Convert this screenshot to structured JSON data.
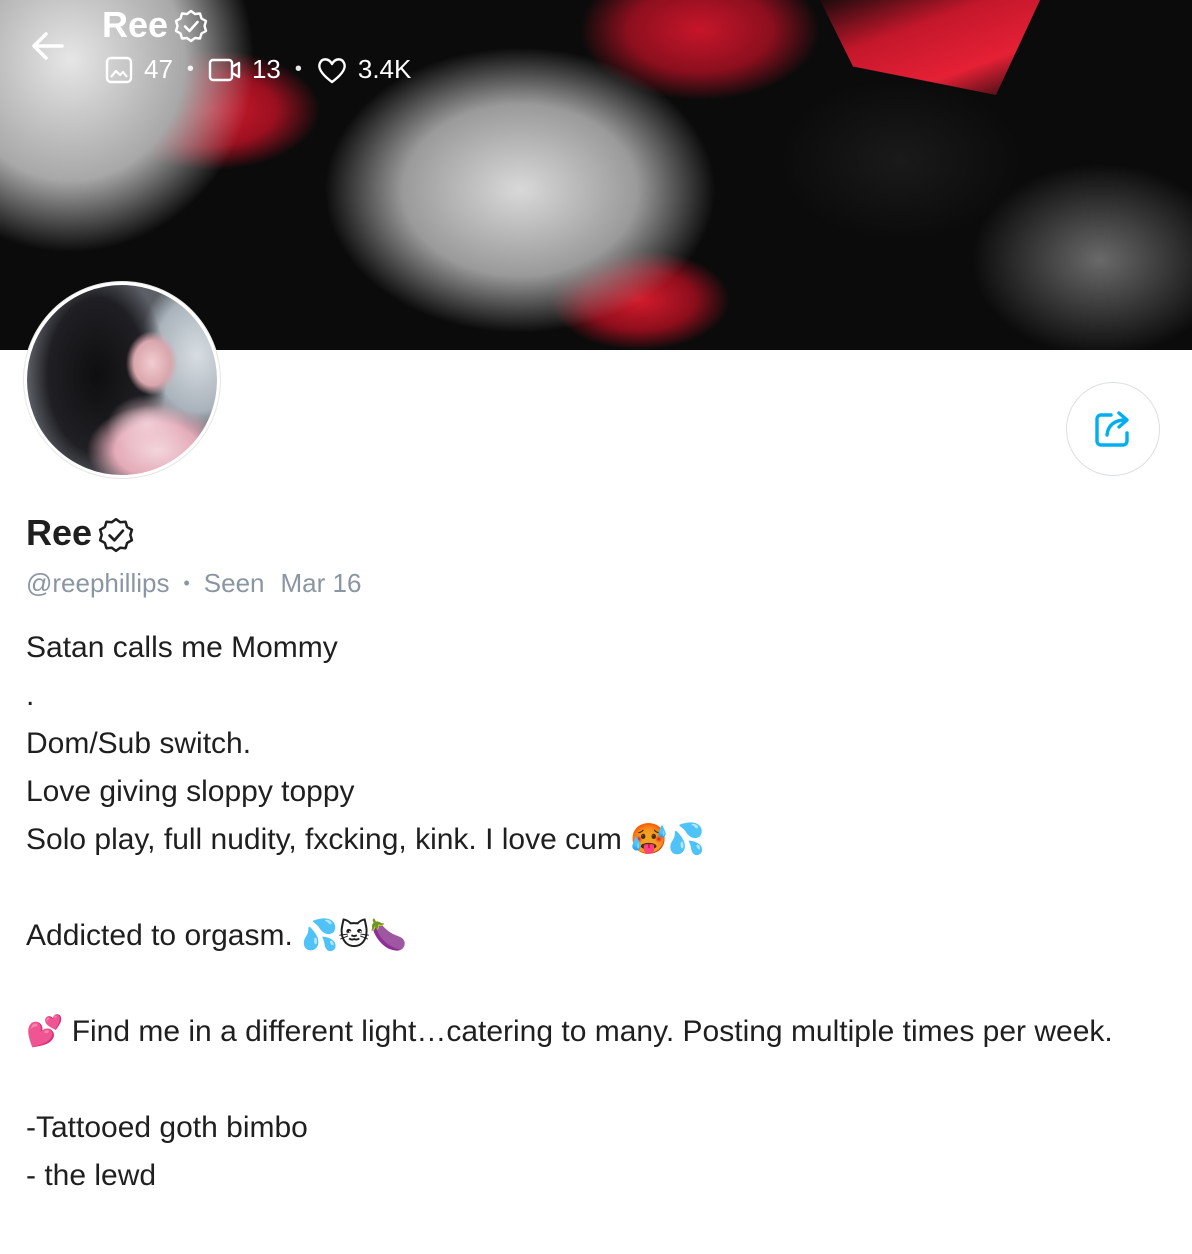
{
  "header": {
    "title": "Ree",
    "stats": {
      "photos": "47",
      "videos": "13",
      "likes": "3.4K"
    }
  },
  "profile": {
    "name": "Ree",
    "handle": "@reephillips",
    "seen_label": "Seen",
    "seen_date": "Mar 16",
    "verified": true
  },
  "bio": {
    "lines": [
      "Satan calls me Mommy",
      ".",
      "Dom/Sub switch.",
      "Love giving sloppy toppy",
      "Solo play, full nudity, fxcking, kink. I love cum 🥵💦",
      "",
      "Addicted to orgasm. 💦🐱🍆",
      "",
      "💕 Find me in a different light…catering to many. Posting multiple times per week.",
      "",
      "-Tattooed goth bimbo",
      "- the lewd"
    ]
  },
  "colors": {
    "accent": "#00aff0",
    "muted_text": "#8a96a3",
    "text": "#1f1f1f"
  },
  "icons": {
    "back": "arrow-left-icon",
    "photos": "image-icon",
    "videos": "video-icon",
    "likes": "heart-icon",
    "share": "share-icon",
    "verified": "verified-badge-icon"
  }
}
